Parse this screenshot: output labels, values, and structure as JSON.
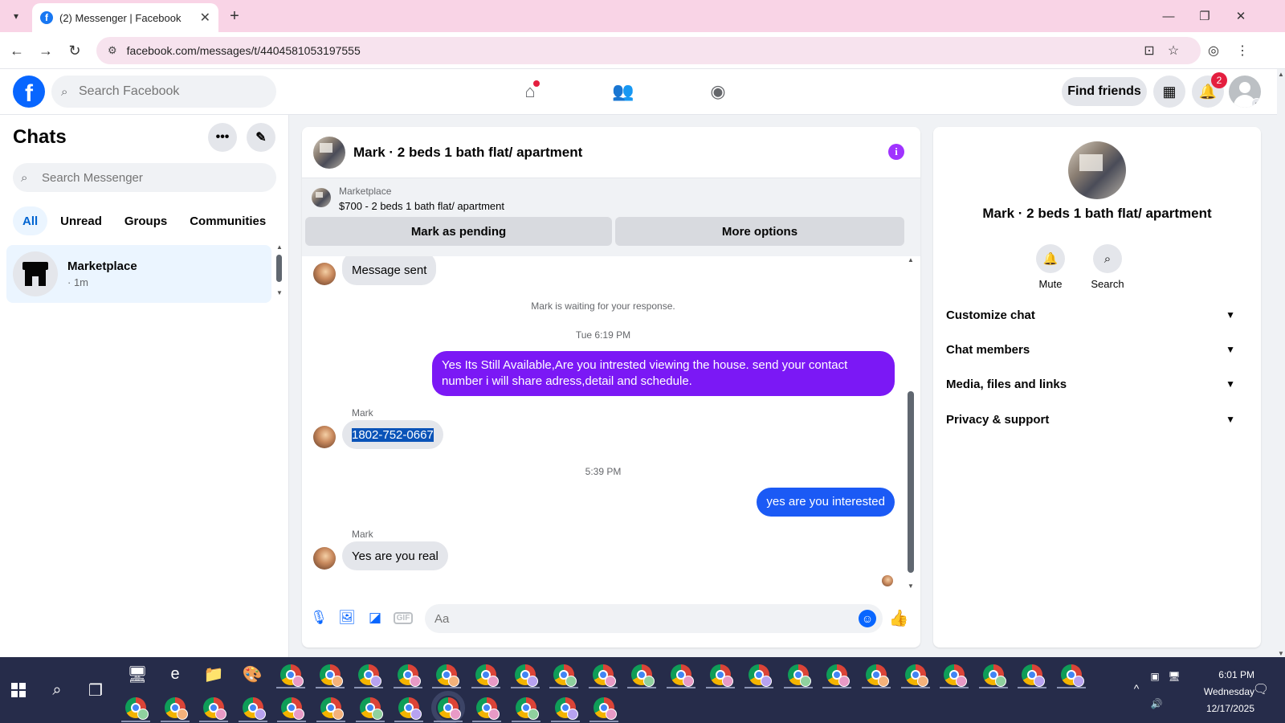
{
  "browser": {
    "tab_title": "(2) Messenger | Facebook",
    "url": "facebook.com/messages/t/4404581053197555",
    "new_tab_label": "+",
    "minimize": "—",
    "restore": "❐",
    "close": "✕"
  },
  "fb_header": {
    "logo": "f",
    "search_placeholder": "Search Facebook",
    "find_friends": "Find friends",
    "notification_count": "2"
  },
  "chats": {
    "title": "Chats",
    "search_placeholder": "Search Messenger",
    "filters": [
      "All",
      "Unread",
      "Groups",
      "Communities"
    ],
    "active_filter": "All",
    "conversations": [
      {
        "name": "Marketplace",
        "meta": "· 1m"
      }
    ]
  },
  "conversation": {
    "title": "Mark · 2 beds 1 bath flat/ apartment",
    "marketplace_label": "Marketplace",
    "listing": "$700 - 2 beds 1 bath flat/ apartment",
    "mark_pending": "Mark as pending",
    "more_options": "More options",
    "messages": {
      "sent_notice": "Message sent",
      "waiting": "Mark is waiting for your response.",
      "time1": "Tue 6:19 PM",
      "out1": "Yes Its Still Available,Are you intrested viewing the house. send your contact number i will share adress,detail and schedule.",
      "sender1": "Mark",
      "in1": "1802-752-0667",
      "time2": "5:39 PM",
      "out2": "yes are you interested",
      "sender2": "Mark",
      "in2": "Yes are you real"
    },
    "composer_placeholder": "Aa"
  },
  "info_panel": {
    "name": "Mark · 2 beds 1 bath flat/ apartment",
    "actions": [
      "Mute",
      "Search"
    ],
    "sections": [
      "Customize chat",
      "Chat members",
      "Media, files and links",
      "Privacy & support"
    ]
  },
  "taskbar": {
    "time": "6:01 PM",
    "day": "Wednesday",
    "date": "12/17/2025"
  },
  "colors": {
    "fb_blue": "#0866ff",
    "out_bubble_purple": "#7b18f5",
    "out_bubble_blue": "#1b5af5",
    "taskbar": "#262c4a",
    "tabbar": "#f9d4e6"
  }
}
